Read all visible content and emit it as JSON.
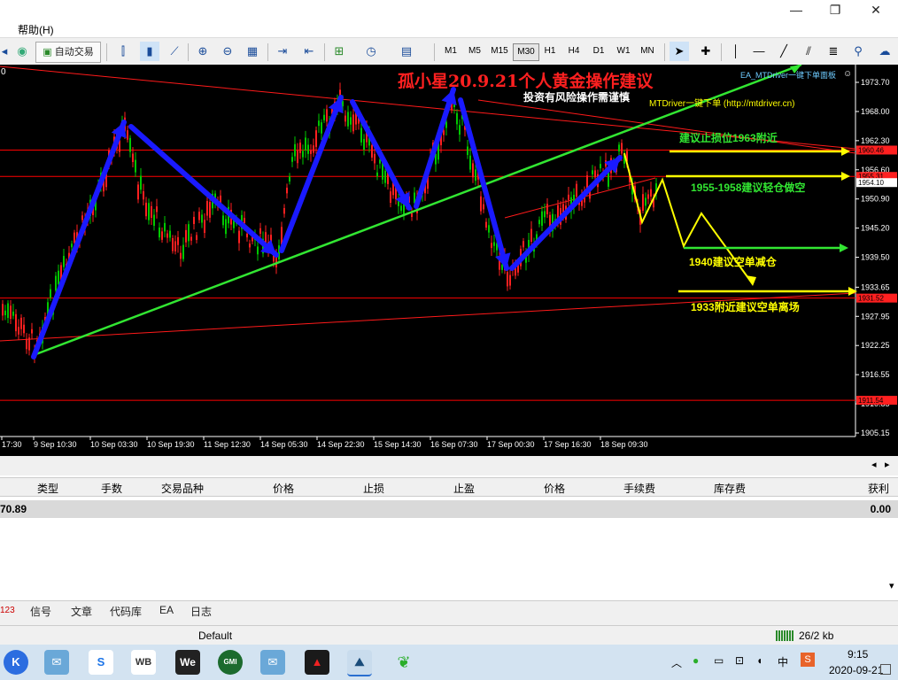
{
  "window": {
    "minimize_glyph": "—",
    "maximize_glyph": "❐",
    "close_glyph": "✕"
  },
  "menu": {
    "help": "帮助(H)"
  },
  "toolbar": {
    "auto_trade": "自动交易",
    "timeframes": [
      "M1",
      "M5",
      "M15",
      "M30",
      "H1",
      "H4",
      "D1",
      "W1",
      "MN"
    ],
    "active_timeframe": "M30"
  },
  "chart": {
    "corner_label": "0",
    "title": "孤小星20.9.21个人黄金操作建议",
    "subtitle": "投资有风险操作需谨慎",
    "ea_label": "EA_MTDriver一键下单面板",
    "mtdriver_label": "MTDriver一键下单 (http://mtdriver.cn)",
    "annotations": {
      "stop_loss": "建议止损位1963附近",
      "sell_zone": "1955-1958建议轻仓做空",
      "reduce": "1940建议空单减仓",
      "exit": "1933附近建议空单离场"
    },
    "price_axis": [
      "1973.70",
      "1968.00",
      "1962.30",
      "1956.60",
      "1950.90",
      "1945.20",
      "1939.50",
      "1933.65",
      "1927.95",
      "1922.25",
      "1916.55",
      "1910.85",
      "1905.15"
    ],
    "price_tags": {
      "h1": "1960.46",
      "h2": "1955.31",
      "bid": "1954.10",
      "h3": "1931.52",
      "h4": "1911.54"
    },
    "time_axis": [
      "17:30",
      "9 Sep 10:30",
      "10 Sep 03:30",
      "10 Sep 19:30",
      "11 Sep 12:30",
      "14 Sep 05:30",
      "14 Sep 22:30",
      "15 Sep 14:30",
      "16 Sep 07:30",
      "17 Sep 00:30",
      "17 Sep 16:30",
      "18 Sep 09:30"
    ],
    "colors": {
      "up": "#00c800",
      "down": "#ff2020",
      "trend": "#32e632",
      "wave": "#1a1aff",
      "forecast": "#ffff00",
      "title": "#ff2020"
    }
  },
  "terminal": {
    "headers": [
      "类型",
      "手数",
      "交易品种",
      "价格",
      "止损",
      "止盈",
      "价格",
      "手续费",
      "库存费",
      "获利"
    ],
    "balance_left": "70.89",
    "profit": "0.00"
  },
  "tabs": {
    "count": "123",
    "items": [
      "信号",
      "文章",
      "代码库",
      "EA",
      "日志"
    ]
  },
  "status": {
    "profile": "Default",
    "traffic": "26/2 kb"
  },
  "taskbar": {
    "apps": [
      "K",
      "mail",
      "S",
      "WB",
      "We",
      "GMI",
      "mail2",
      "A",
      "mt",
      "wechat"
    ],
    "time": "9:15",
    "date": "2020-09-21",
    "ime": "中"
  }
}
